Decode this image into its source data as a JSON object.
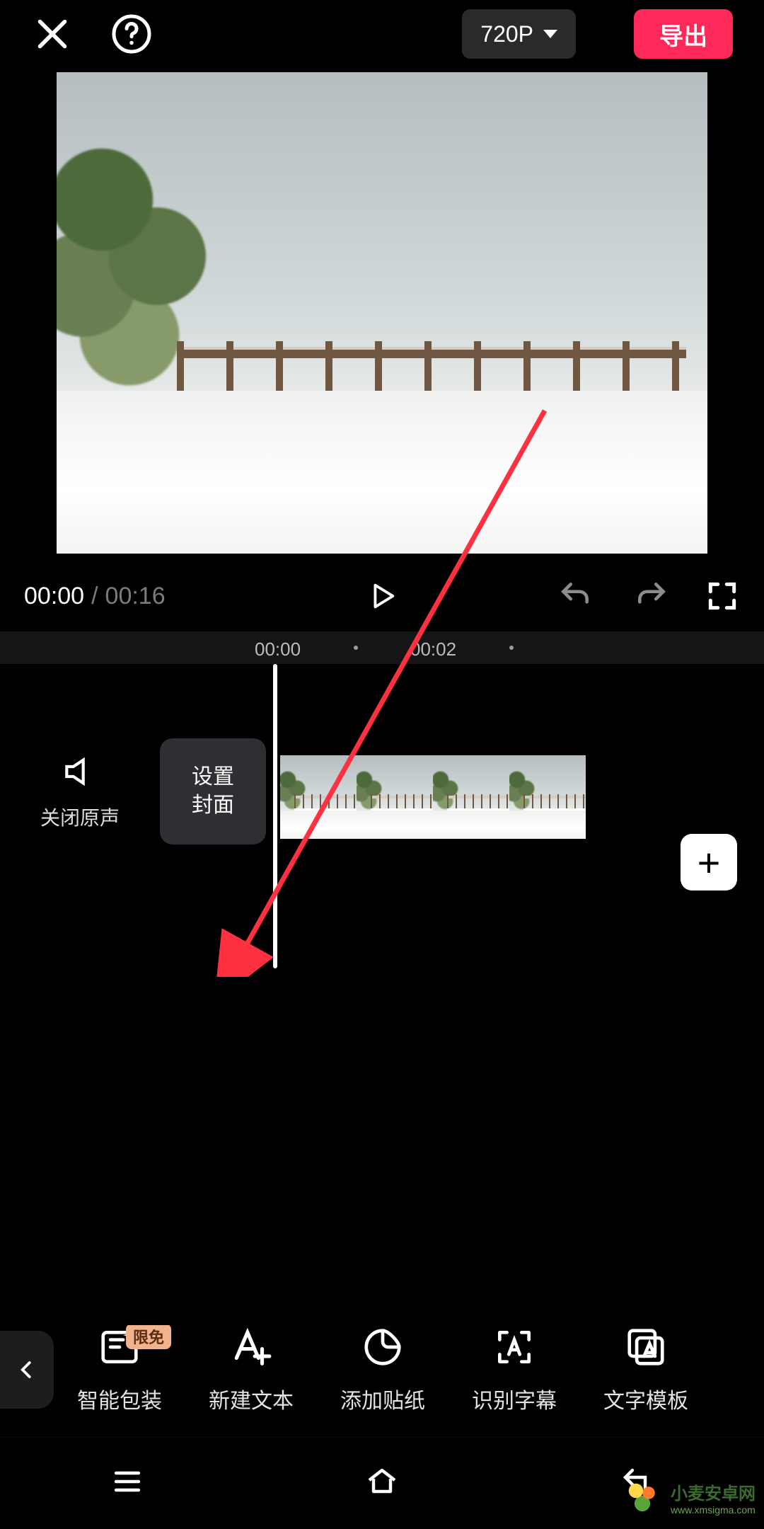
{
  "header": {
    "resolution_label": "720P",
    "export_label": "导出"
  },
  "playback": {
    "current_time": "00:00",
    "separator": "/",
    "total_time": "00:16"
  },
  "ruler": {
    "marks": [
      "00:00",
      "00:02"
    ]
  },
  "timeline": {
    "mute_label": "关闭原声",
    "cover_line1": "设置",
    "cover_line2": "封面",
    "add_clip_label": "+"
  },
  "toolbar": {
    "badge_label": "限免",
    "items": [
      {
        "id": "smart-package",
        "label": "智能包装"
      },
      {
        "id": "new-text",
        "label": "新建文本"
      },
      {
        "id": "add-sticker",
        "label": "添加贴纸"
      },
      {
        "id": "auto-caption",
        "label": "识别字幕"
      },
      {
        "id": "text-template",
        "label": "文字模板"
      }
    ]
  },
  "watermark": {
    "title": "小麦安卓网",
    "subtitle": "www.xmsigma.com"
  }
}
